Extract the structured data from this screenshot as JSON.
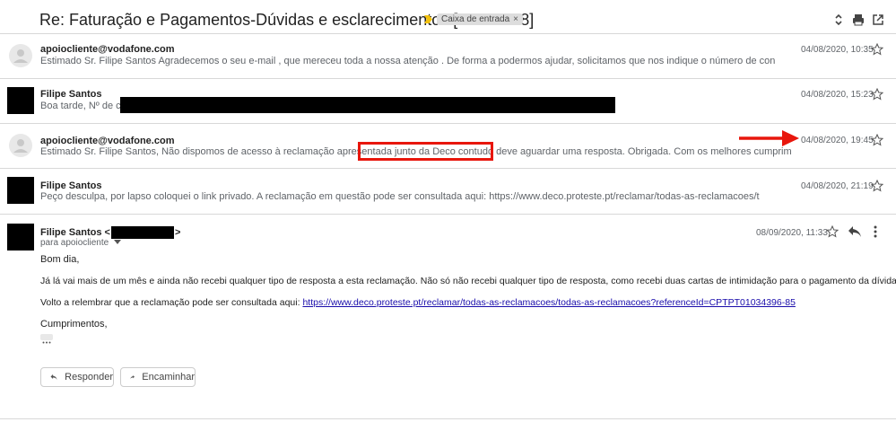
{
  "header": {
    "subject": "Re: Faturação e Pagamentos-Dúvidas e esclarecimentos [#2812948]",
    "label": "Caixa de entrada",
    "label_remove": "×"
  },
  "messages": [
    {
      "sender": "apoiocliente@vodafone.com",
      "snippet": "Estimado Sr. Filipe Santos Agradecemos o seu e-mail , que mereceu toda a nossa atenção . De forma a podermos ajudar, solicitamos que nos indique o número de con",
      "date": "04/08/2020, 10:35"
    },
    {
      "sender": "Filipe Santos",
      "snippet": "Boa tarde, Nº de conta:",
      "date": "04/08/2020, 15:23"
    },
    {
      "sender": "apoiocliente@vodafone.com",
      "snippet": "Estimado Sr. Filipe Santos, Não dispomos de acesso à reclamação apresentada junto da Deco contudo deve aguardar uma resposta. Obrigada. Com os melhores cumprim",
      "date": "04/08/2020, 19:45"
    },
    {
      "sender": "Filipe Santos",
      "snippet": "Peço desculpa, por lapso coloquei o link privado. A reclamação em questão pode ser consultada aqui: https://www.deco.proteste.pt/reclamar/todas-as-reclamacoes/t",
      "date": "04/08/2020, 21:19"
    }
  ],
  "expanded": {
    "sender": "Filipe Santos <",
    "sender_end": ">",
    "to": "para apoiocliente",
    "date": "08/09/2020, 11:33",
    "greeting": "Bom dia,",
    "para1": "Já lá vai mais de um mês e ainda não recebi qualquer tipo de resposta a esta reclamação. Não só não recebi qualquer tipo de resposta, como recebi duas cartas de intimidação para o pagamento da dívida.",
    "para2_prefix": "Volto a relembrar que a reclamação pode ser consultada aqui: ",
    "para2_link": "https://www.deco.proteste.pt/reclamar/todas-as-reclamacoes/todas-as-reclamacoes?referenceId=CPTPT01034396-85",
    "closing": "Cumprimentos,"
  },
  "actions": {
    "reply": "Responder",
    "forward": "Encaminhar"
  },
  "colors": {
    "highlight": "#e8160c",
    "link": "#1a0dab"
  }
}
